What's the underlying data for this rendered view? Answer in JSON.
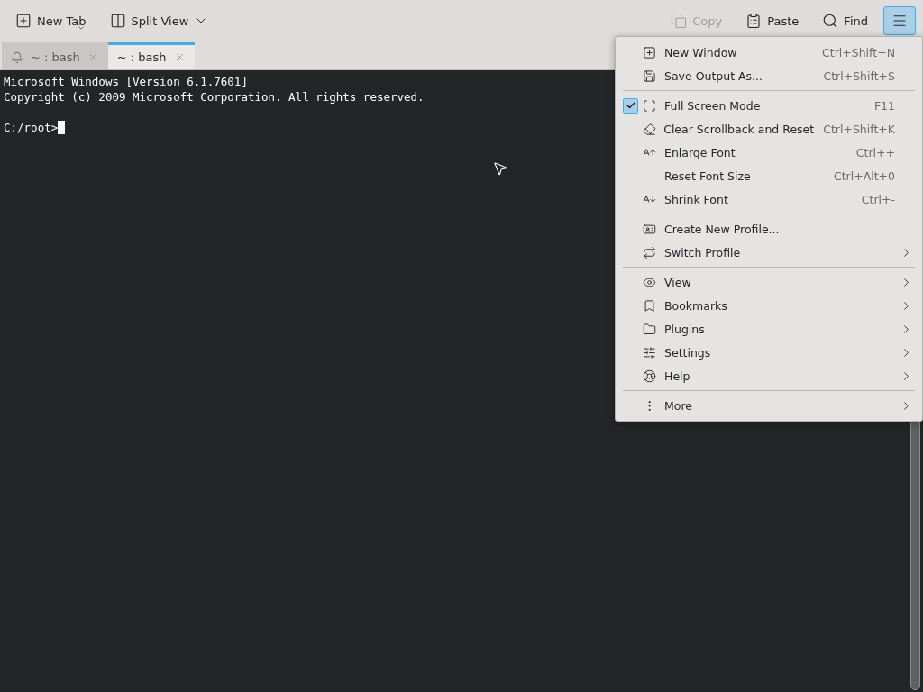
{
  "toolbar": {
    "left": [
      {
        "label": "New Tab",
        "caret": true
      },
      {
        "label": "Split View",
        "caret": true
      }
    ],
    "right": [
      {
        "kind": "copy",
        "label": "Copy",
        "disabled": true,
        "selected": false
      },
      {
        "kind": "paste",
        "label": "Paste",
        "disabled": false,
        "selected": false
      },
      {
        "kind": "find",
        "label": "Find",
        "disabled": false,
        "selected": false
      },
      {
        "kind": "menu",
        "disabled": false,
        "selected": true
      }
    ]
  },
  "tabs": [
    {
      "label": "~ : bash",
      "selected": false,
      "alert": true
    },
    {
      "label": "~ : bash",
      "selected": true,
      "alert": false
    }
  ],
  "terminal": {
    "blocks": [
      [
        "Microsoft Windows [Version 6.1.7601]",
        "Copyright (c) 2009 Microsoft Corporation. All rights reserved."
      ],
      [
        "C:/root>"
      ]
    ]
  },
  "menu": {
    "sections": [
      [
        {
          "label": "New Window",
          "shortcut": "Ctrl+Shift+N",
          "kind": "action",
          "submenu": false
        },
        {
          "label": "Save Output As...",
          "shortcut": "Ctrl+Shift+S",
          "kind": "action",
          "submenu": false
        }
      ],
      [
        {
          "label": "Full Screen Mode",
          "shortcut": "F11",
          "kind": "check",
          "checked": true,
          "submenu": false
        },
        {
          "label": "Clear Scrollback and Reset",
          "shortcut": "Ctrl+Shift+K",
          "kind": "action",
          "submenu": false
        },
        {
          "label": "Enlarge Font",
          "shortcut": "Ctrl++",
          "kind": "action",
          "submenu": false
        },
        {
          "label": "Reset Font Size",
          "shortcut": "Ctrl+Alt+0",
          "kind": "action",
          "submenu": false
        },
        {
          "label": "Shrink Font",
          "shortcut": "Ctrl+-",
          "kind": "action",
          "submenu": false
        }
      ],
      [
        {
          "label": "Create New Profile...",
          "kind": "action",
          "submenu": false
        },
        {
          "label": "Switch Profile",
          "kind": "action",
          "submenu": true
        }
      ],
      [
        {
          "label": "View",
          "kind": "action",
          "submenu": true
        },
        {
          "label": "Bookmarks",
          "kind": "action",
          "submenu": true
        },
        {
          "label": "Plugins",
          "kind": "action",
          "submenu": true
        },
        {
          "label": "Settings",
          "kind": "action",
          "submenu": true
        },
        {
          "label": "Help",
          "kind": "action",
          "submenu": true
        }
      ],
      [
        {
          "label": "More",
          "kind": "action",
          "submenu": true
        }
      ]
    ]
  }
}
